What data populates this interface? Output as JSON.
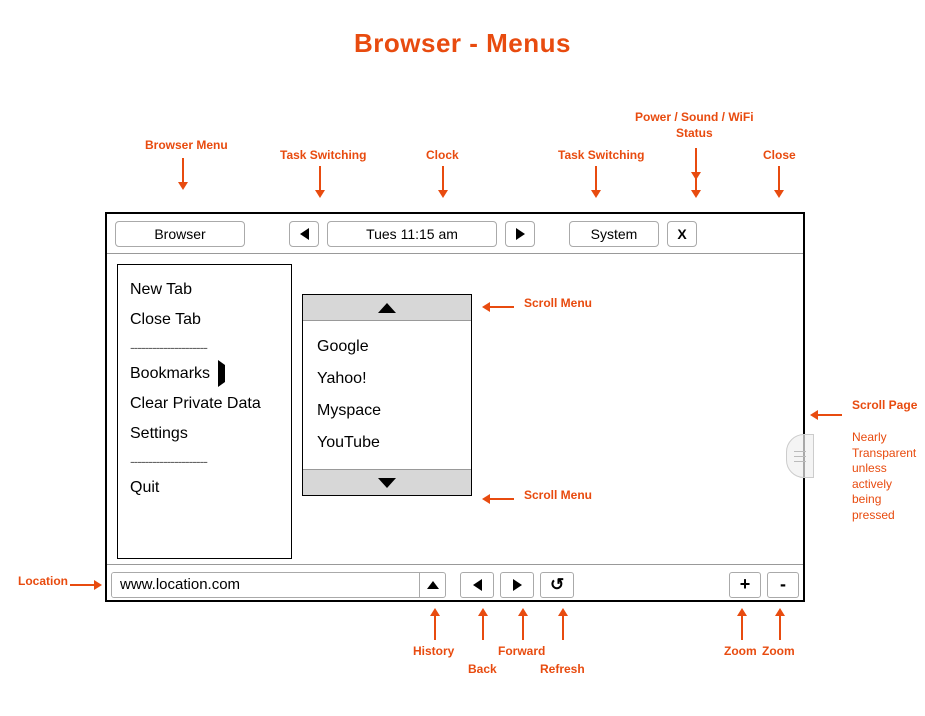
{
  "title": "Browser - Menus",
  "annotations": {
    "browser_menu": "Browser Menu",
    "task_switching": "Task Switching",
    "clock": "Clock",
    "power_sound_wifi": "Power / Sound / WiFi\nStatus",
    "close": "Close",
    "scroll_menu": "Scroll Menu",
    "scroll_page": "Scroll Page",
    "scroll_page_note": "Nearly\nTransparent\nunless actively\nbeing pressed",
    "location": "Location",
    "history": "History",
    "back": "Back",
    "forward": "Forward",
    "refresh": "Refresh",
    "zoom": "Zoom"
  },
  "topbar": {
    "browser_label": "Browser",
    "clock_label": "Tues 11:15 am",
    "system_label": "System",
    "close_label": "X"
  },
  "browser_menu": {
    "items": [
      "New Tab",
      "Close Tab",
      "---------------------",
      "Bookmarks",
      "Clear Private Data",
      "Settings",
      "---------------------",
      "Quit"
    ],
    "submenu_index": 3
  },
  "bookmarks_submenu": {
    "items": [
      "Google",
      "Yahoo!",
      "Myspace",
      "YouTube"
    ]
  },
  "bottombar": {
    "location_value": "www.location.com",
    "zoom_in": "+",
    "zoom_out": "-"
  }
}
